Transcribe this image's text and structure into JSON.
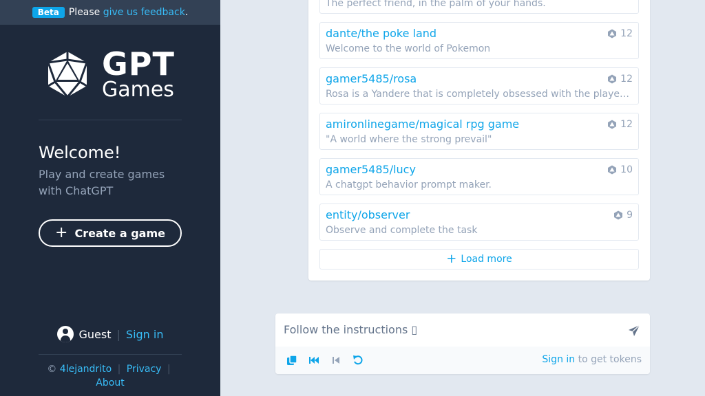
{
  "beta": {
    "badge": "Beta",
    "prefix": "Please",
    "link": "give us feedback",
    "suffix": "."
  },
  "logo": {
    "line1": "GPT",
    "line2": "Games"
  },
  "welcome": {
    "title": "Welcome!",
    "subtitle": "Play and create games with ChatGPT"
  },
  "create_button": "Create a game",
  "user": {
    "name": "Guest",
    "separator": "|",
    "signin": "Sign in"
  },
  "footer": {
    "copyright": "©",
    "author": "4lejandrito",
    "privacy": "Privacy",
    "about": "About"
  },
  "games": [
    {
      "title": "",
      "description": "The perfect friend, in the palm of your hands.",
      "count": ""
    },
    {
      "title": "dante/the poke land",
      "description": "Welcome to the world of Pokemon",
      "count": "12"
    },
    {
      "title": "gamer5485/rosa",
      "description": "Rosa is a Yandere that is completely obsessed with the player and will do anything to keep them",
      "count": "12"
    },
    {
      "title": "amironlinegame/magical rpg game",
      "description": "\"A world where the strong prevail\"",
      "count": "12"
    },
    {
      "title": "gamer5485/lucy",
      "description": "A chatgpt behavior prompt maker.",
      "count": "10"
    },
    {
      "title": "entity/observer",
      "description": "Observe and complete the task",
      "count": "9"
    }
  ],
  "load_more": "Load more",
  "input": {
    "text": "Follow the instructions ▯",
    "signin": "Sign in",
    "tokens_suffix": "to get tokens"
  },
  "icons": {
    "logo": "d20-dice-icon",
    "count": "dice-icon",
    "send": "paper-plane-icon",
    "copy": "copy-icon",
    "restart": "fast-backward-icon",
    "back": "step-backward-icon",
    "undo": "undo-icon"
  },
  "colors": {
    "sidebar": "#1e293b",
    "accent": "#0ea5e9",
    "background": "#e2e8f0"
  }
}
